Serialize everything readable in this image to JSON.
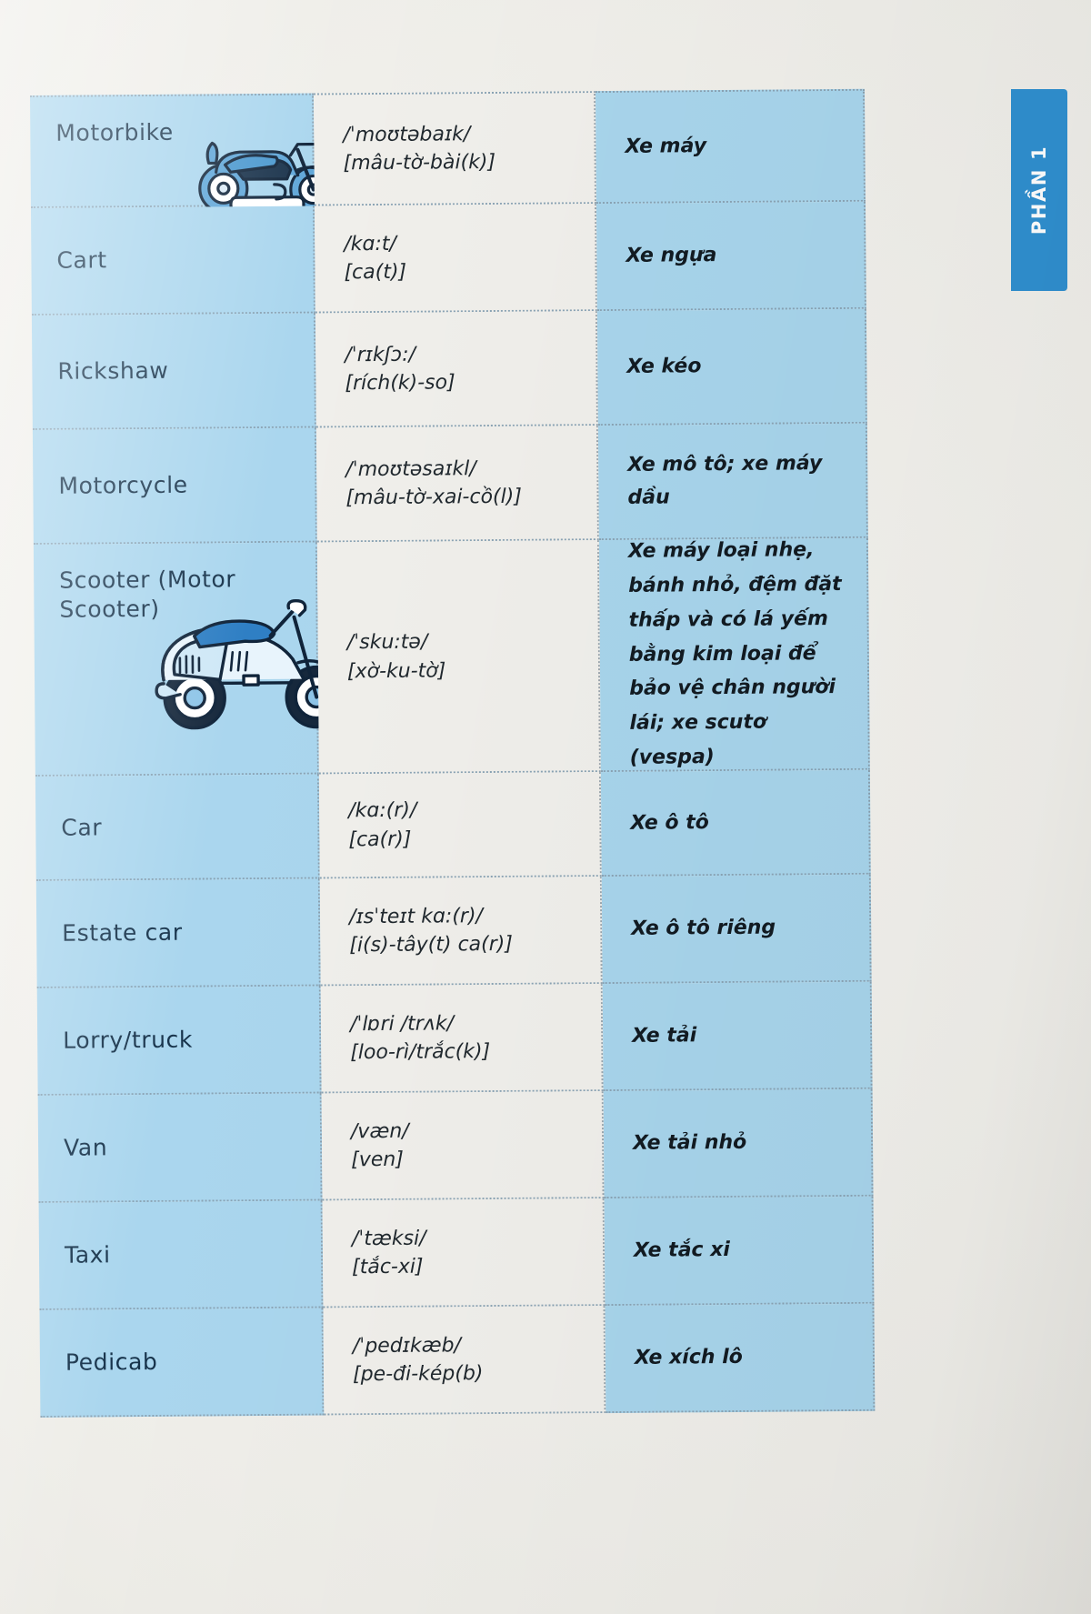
{
  "section_tab": {
    "label": "PHẦN 1",
    "color": "#2f8fcf"
  },
  "colors": {
    "word_cell_bg": "#aad6ee",
    "ipa_cell_bg": "#f0efeb",
    "viet_cell_bg": "#a8d5ec",
    "tab_blue": "#2f8fcf",
    "ink": "#17334b"
  },
  "table": {
    "rows": [
      {
        "word": "Motorbike",
        "ipa": "/ˈmoʊtəbaɪk/",
        "respell": "[mâu-tờ-bài(k)]",
        "vietnamese": "Xe máy",
        "illustration": "motorbike-illustration"
      },
      {
        "word": "Cart",
        "ipa": "/kɑ:t/",
        "respell": "[ca(t)]",
        "vietnamese": "Xe ngựa",
        "illustration": null
      },
      {
        "word": "Rickshaw",
        "ipa": "/ˈrɪkʃɔ:/",
        "respell": "[rích(k)-so]",
        "vietnamese": "Xe kéo",
        "illustration": null
      },
      {
        "word": "Motorcycle",
        "ipa": "/ˈmoʊtəsaɪkl/",
        "respell": "[mâu-tờ-xai-cồ(l)]",
        "vietnamese": "Xe mô tô; xe máy dầu",
        "illustration": null
      },
      {
        "word": "Scooter (Motor Scooter)",
        "ipa": "/ˈsku:tə/",
        "respell": "[xờ-ku-tờ]",
        "vietnamese": "Xe máy loại nhẹ, bánh nhỏ, đệm đặt thấp và có lá yếm bằng kim loại để bảo vệ chân người lái; xe scutơ (vespa)",
        "illustration": "scooter-illustration"
      },
      {
        "word": "Car",
        "ipa": "/kɑ:(r)/",
        "respell": "[ca(r)]",
        "vietnamese": "Xe ô tô",
        "illustration": "car-illustration"
      },
      {
        "word": "Estate car",
        "ipa": "/ɪsˈteɪt kɑ:(r)/",
        "respell": "[i(s)-tây(t) ca(r)]",
        "vietnamese": "Xe ô tô riêng",
        "illustration": null
      },
      {
        "word": "Lorry/truck",
        "ipa": "/ˈlɒri /trʌk/",
        "respell": "[loo-rì/trắc(k)]",
        "vietnamese": "Xe tải",
        "illustration": null
      },
      {
        "word": "Van",
        "ipa": "/væn/",
        "respell": "[ven]",
        "vietnamese": "Xe tải nhỏ",
        "illustration": null
      },
      {
        "word": "Taxi",
        "ipa": "/ˈtæksi/",
        "respell": "[tắc-xi]",
        "vietnamese": "Xe tắc xi",
        "illustration": null
      },
      {
        "word": "Pedicab",
        "ipa": "/ˈpedɪkæb/",
        "respell": "[pe-đi-kép(b)",
        "vietnamese": "Xe xích lô",
        "illustration": null
      }
    ]
  }
}
